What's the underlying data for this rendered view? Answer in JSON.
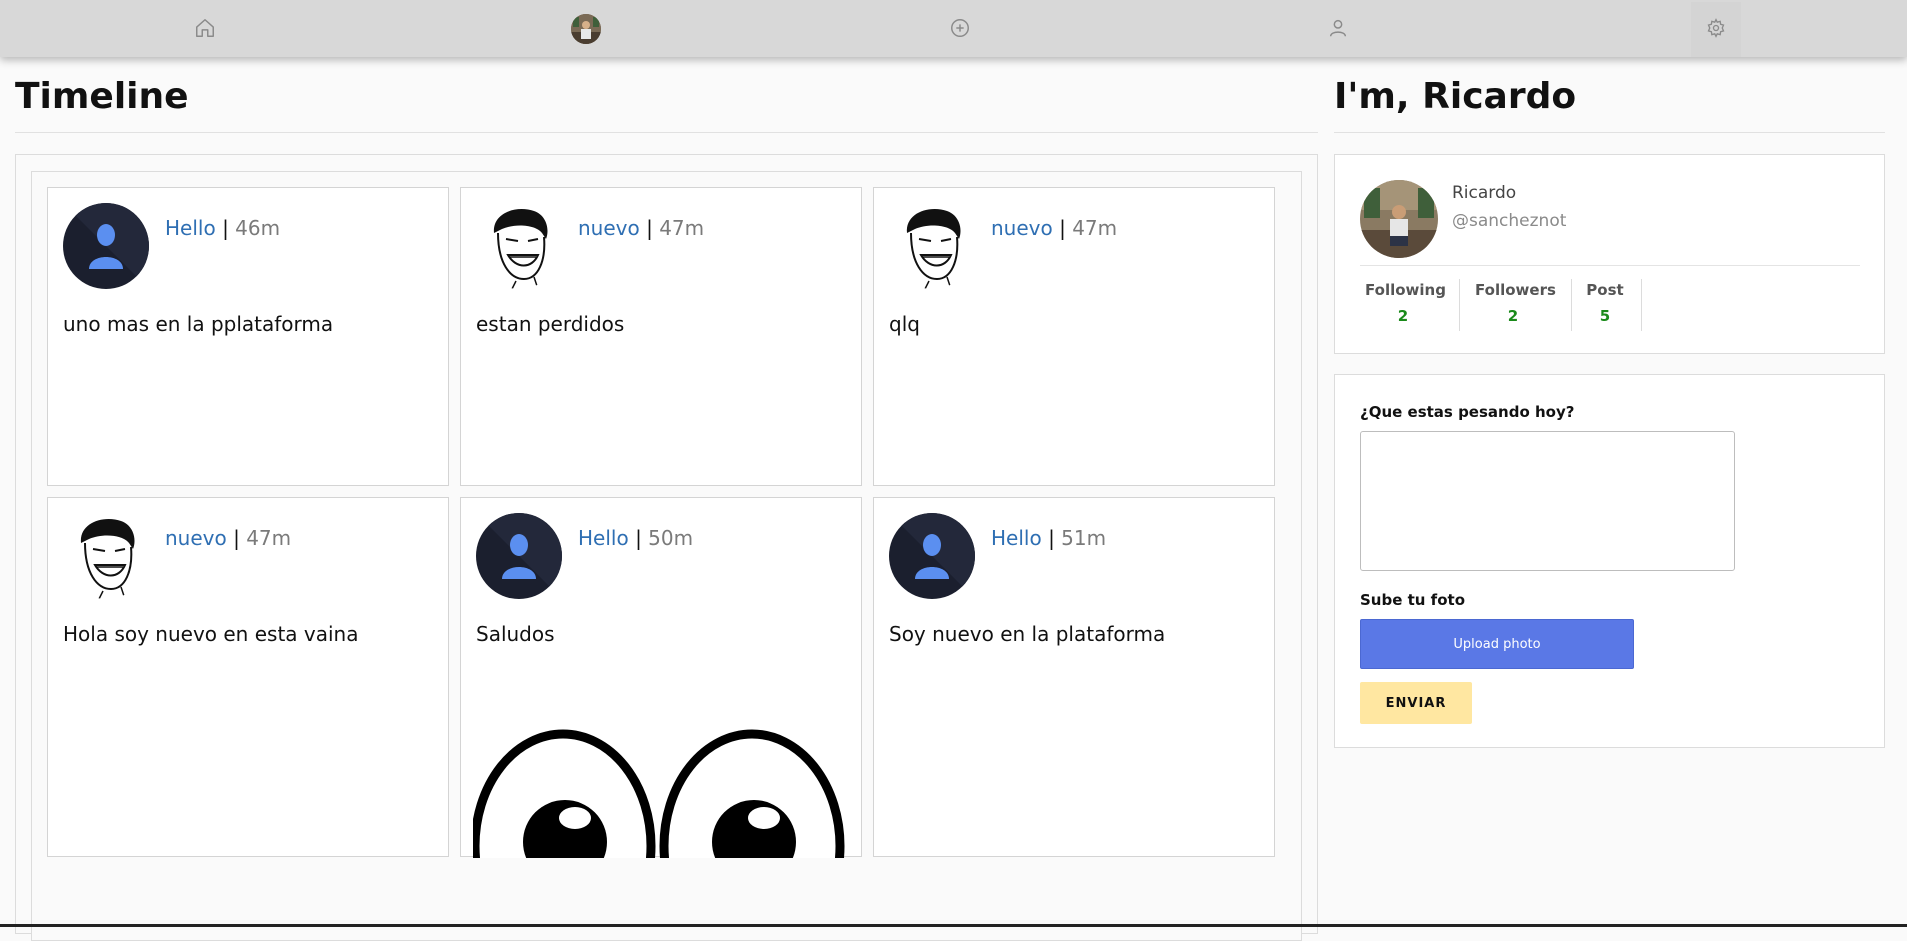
{
  "nav": {
    "items": [
      {
        "icon": "home-icon"
      },
      {
        "icon": "avatar"
      },
      {
        "icon": "plus-circle-icon"
      },
      {
        "icon": "user-icon"
      },
      {
        "icon": "gear-icon"
      }
    ]
  },
  "timeline": {
    "title": "Timeline",
    "posts": [
      {
        "user": "Hello",
        "time": "46m",
        "text": "uno mas en la pplataforma",
        "avatar": "default-avatar"
      },
      {
        "user": "nuevo",
        "time": "47m",
        "text": "estan perdidos",
        "avatar": "meme-avatar"
      },
      {
        "user": "nuevo",
        "time": "47m",
        "text": "qlq",
        "avatar": "meme-avatar"
      },
      {
        "user": "nuevo",
        "time": "47m",
        "text": "Hola soy nuevo en esta vaina",
        "avatar": "meme-avatar"
      },
      {
        "user": "Hello",
        "time": "50m",
        "text": "Saludos",
        "avatar": "default-avatar",
        "image": "cartoon-eyes"
      },
      {
        "user": "Hello",
        "time": "51m",
        "text": "Soy nuevo en la plataforma",
        "avatar": "default-avatar"
      }
    ],
    "separator": "|"
  },
  "profile": {
    "title": "I'm, Ricardo",
    "name": "Ricardo",
    "handle": "@sancheznot",
    "stats": [
      {
        "label": "Following",
        "value": "2"
      },
      {
        "label": "Followers",
        "value": "2"
      },
      {
        "label": "Post",
        "value": "5"
      }
    ]
  },
  "compose": {
    "prompt_label": "¿Que estas pesando hoy?",
    "textarea_value": "",
    "photo_label": "Sube tu foto",
    "upload_label": "Upload photo",
    "send_label": "ENVIAR"
  },
  "colors": {
    "link": "#2f6fb3",
    "stat_value": "#1a8a1a",
    "upload_button": "#5a78e6",
    "send_button": "#ffe7a1",
    "navbar": "#d8d8d8"
  }
}
